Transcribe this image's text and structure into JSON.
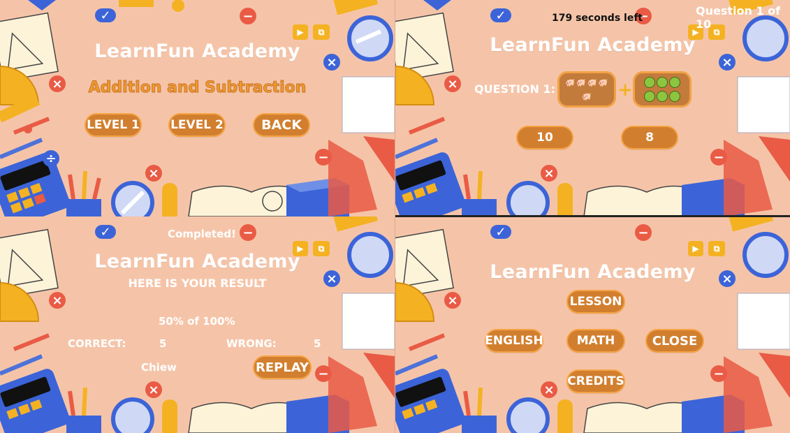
{
  "app_title": "LearnFun Academy",
  "colors": {
    "background": "#f5c4a8",
    "button_fill": "#d17f2f",
    "button_border": "#f6a343",
    "subtitle": "#ee9a2d"
  },
  "panel_level_select": {
    "subtitle": "Addition and Subtraction",
    "buttons": {
      "level1": "LEVEL 1",
      "level2": "LEVEL 2",
      "back": "BACK"
    }
  },
  "panel_question": {
    "timer": "179 seconds left",
    "progress": "Question 1 of 10",
    "question_label": "QUESTION 1:",
    "answers": {
      "a": "10",
      "b": "8"
    },
    "cards": {
      "left_icon": "pig-icon",
      "right_icon": "apple-icon",
      "operator": "plus"
    }
  },
  "panel_result": {
    "status": "Completed!",
    "heading": "HERE IS YOUR RESULT",
    "score": "50% of 100%",
    "correct_label": "CORRECT:",
    "correct_value": "5",
    "wrong_label": "WRONG:",
    "wrong_value": "5",
    "player": "Chiew",
    "replay": "REPLAY"
  },
  "panel_menu": {
    "lesson": "LESSON",
    "english": "ENGLISH",
    "math": "MATH",
    "close": "CLOSE",
    "credits": "CREDITS"
  }
}
